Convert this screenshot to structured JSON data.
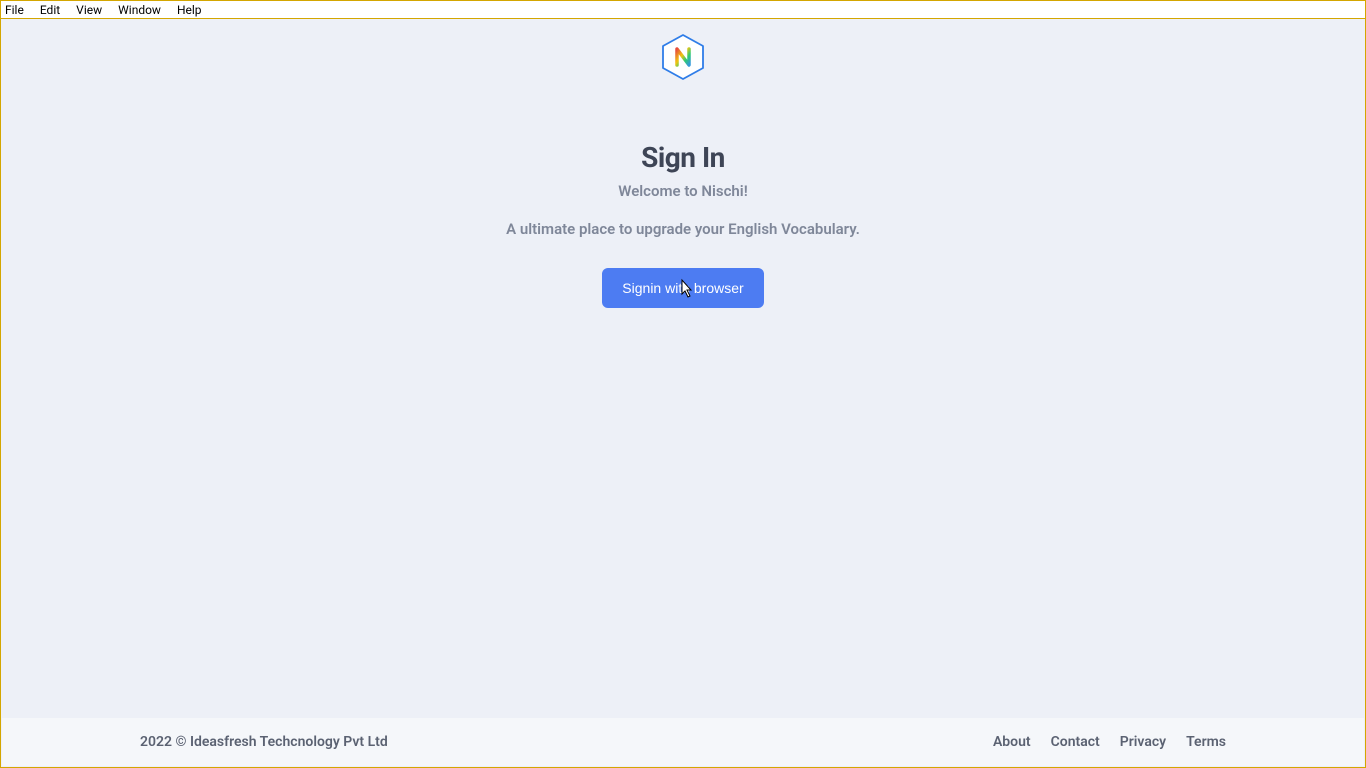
{
  "menu": {
    "items": [
      "File",
      "Edit",
      "View",
      "Window",
      "Help"
    ]
  },
  "main": {
    "heading": "Sign In",
    "subheading": "Welcome to Nischi!",
    "tagline": "A ultimate place to upgrade your English Vocabulary.",
    "signin_button": "Signin with browser"
  },
  "footer": {
    "copyright": "2022 © Ideasfresh Techcnology Pvt Ltd",
    "links": [
      "About",
      "Contact",
      "Privacy",
      "Terms"
    ]
  }
}
